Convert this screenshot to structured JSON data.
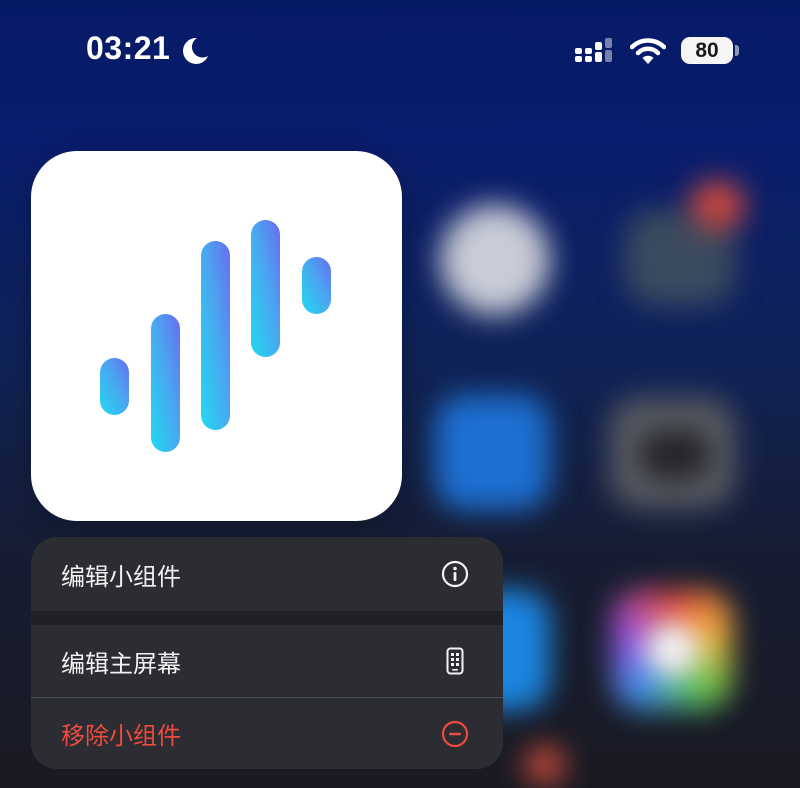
{
  "status_bar": {
    "time": "03:21",
    "focus_icon": "moon-icon",
    "signal_icon": "cellular-signal-icon",
    "wifi_icon": "wifi-icon",
    "battery_level": "80"
  },
  "widget": {
    "icon": "sound-wave-bars-icon",
    "colors": {
      "start": "#22d9f2",
      "end": "#6a6cf0"
    }
  },
  "menu": {
    "items": [
      {
        "label": "编辑小组件",
        "icon": "info-circle-icon"
      },
      {
        "label": "编辑主屏幕",
        "icon": "phone-screen-icon"
      },
      {
        "label": "移除小组件",
        "icon": "minus-circle-icon",
        "color": "#ef4a3e"
      }
    ]
  }
}
